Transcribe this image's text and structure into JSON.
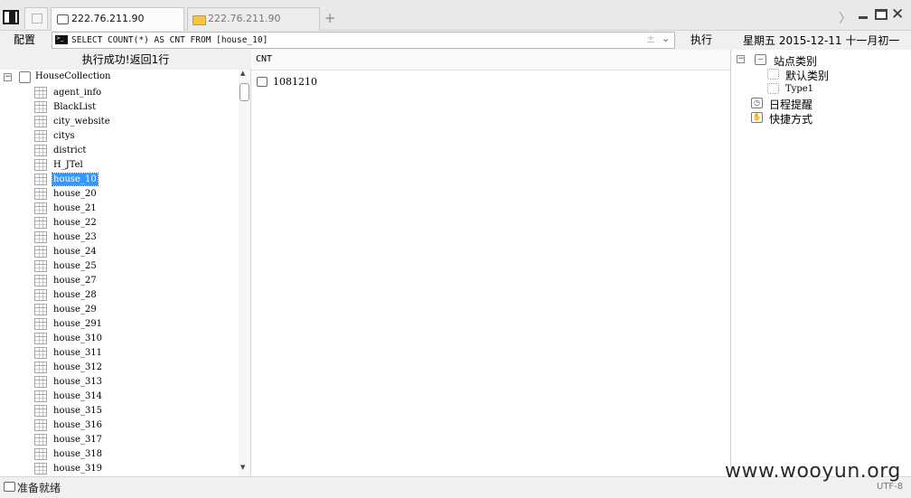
{
  "tabs": [
    {
      "label": "222.76.211.90",
      "active": true,
      "icon": "window-icon"
    },
    {
      "label": "222.76.211.90",
      "active": false,
      "icon": "folder-icon"
    }
  ],
  "toolbar": {
    "config_label": "配置",
    "sql_query": "SELECT COUNT(*) AS CNT FROM [house_10]",
    "plusminus": "±",
    "dropdown": "⌄",
    "execute_label": "执行",
    "date_text": "星期五  2015-12-11  十一月初一"
  },
  "left_panel": {
    "header": "执行成功!返回1行",
    "root": "HouseCollection",
    "selected": "house_10",
    "tables": [
      "agent_info",
      "BlackList",
      "city_website",
      "citys",
      "district",
      "H_JTel",
      "house_10",
      "house_20",
      "house_21",
      "house_22",
      "house_23",
      "house_24",
      "house_25",
      "house_27",
      "house_28",
      "house_29",
      "house_291",
      "house_310",
      "house_311",
      "house_312",
      "house_313",
      "house_314",
      "house_315",
      "house_316",
      "house_317",
      "house_318",
      "house_319"
    ]
  },
  "result": {
    "column": "CNT",
    "value": "1081210"
  },
  "right_panel": {
    "site_category": "站点类别",
    "default_category": "默认类别",
    "type1": "Type1",
    "schedule": "日程提醒",
    "shortcut": "快捷方式"
  },
  "status": {
    "text": "准备就绪",
    "encoding": "UTF-8",
    "watermark": "www.wooyun.org"
  }
}
